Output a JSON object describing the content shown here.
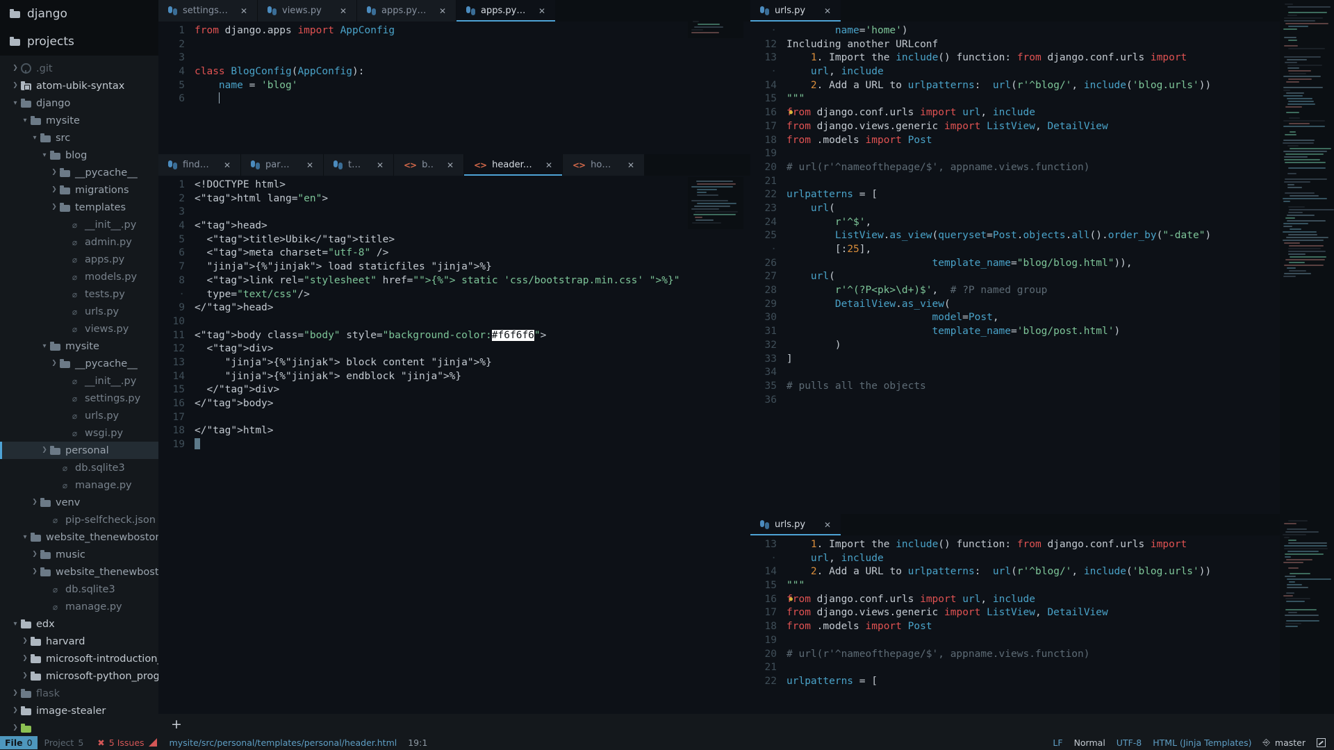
{
  "sidebar": {
    "headers": [
      {
        "label": "django",
        "icon": "folder-icon"
      },
      {
        "label": "projects",
        "icon": "folder-icon"
      }
    ],
    "tree": [
      {
        "label": ".git",
        "depth": 0,
        "type": "dir",
        "arrow": "right",
        "icon": "git-icon",
        "tone": "dim"
      },
      {
        "label": "atom-ubik-syntax",
        "depth": 0,
        "type": "dir",
        "arrow": "right",
        "icon": "repo-icon",
        "tone": "bright"
      },
      {
        "label": "django",
        "depth": 0,
        "type": "dir",
        "arrow": "down",
        "icon": "folder-icon",
        "tone": "normal"
      },
      {
        "label": "mysite",
        "depth": 1,
        "type": "dir",
        "arrow": "down",
        "icon": "folder-icon",
        "tone": "normal"
      },
      {
        "label": "src",
        "depth": 2,
        "type": "dir",
        "arrow": "down",
        "icon": "folder-icon",
        "tone": "normal"
      },
      {
        "label": "blog",
        "depth": 3,
        "type": "dir",
        "arrow": "down",
        "icon": "folder-icon",
        "tone": "normal"
      },
      {
        "label": "__pycache__",
        "depth": 4,
        "type": "dir",
        "arrow": "right",
        "icon": "folder-icon",
        "tone": "normal"
      },
      {
        "label": "migrations",
        "depth": 4,
        "type": "dir",
        "arrow": "right",
        "icon": "folder-icon",
        "tone": "normal"
      },
      {
        "label": "templates",
        "depth": 4,
        "type": "dir",
        "arrow": "right",
        "icon": "folder-icon",
        "tone": "normal"
      },
      {
        "label": "__init__.py",
        "depth": 5,
        "type": "file",
        "arrow": "none",
        "icon": "file-icon",
        "tone": "normal"
      },
      {
        "label": "admin.py",
        "depth": 5,
        "type": "file",
        "arrow": "none",
        "icon": "file-icon",
        "tone": "normal"
      },
      {
        "label": "apps.py",
        "depth": 5,
        "type": "file",
        "arrow": "none",
        "icon": "file-icon",
        "tone": "normal"
      },
      {
        "label": "models.py",
        "depth": 5,
        "type": "file",
        "arrow": "none",
        "icon": "file-icon",
        "tone": "normal"
      },
      {
        "label": "tests.py",
        "depth": 5,
        "type": "file",
        "arrow": "none",
        "icon": "file-icon",
        "tone": "normal"
      },
      {
        "label": "urls.py",
        "depth": 5,
        "type": "file",
        "arrow": "none",
        "icon": "file-icon",
        "tone": "normal"
      },
      {
        "label": "views.py",
        "depth": 5,
        "type": "file",
        "arrow": "none",
        "icon": "file-icon",
        "tone": "normal"
      },
      {
        "label": "mysite",
        "depth": 3,
        "type": "dir",
        "arrow": "down",
        "icon": "folder-icon",
        "tone": "normal"
      },
      {
        "label": "__pycache__",
        "depth": 4,
        "type": "dir",
        "arrow": "right",
        "icon": "folder-icon",
        "tone": "normal"
      },
      {
        "label": "__init__.py",
        "depth": 5,
        "type": "file",
        "arrow": "none",
        "icon": "file-icon",
        "tone": "normal"
      },
      {
        "label": "settings.py",
        "depth": 5,
        "type": "file",
        "arrow": "none",
        "icon": "file-icon",
        "tone": "normal"
      },
      {
        "label": "urls.py",
        "depth": 5,
        "type": "file",
        "arrow": "none",
        "icon": "file-icon",
        "tone": "normal"
      },
      {
        "label": "wsgi.py",
        "depth": 5,
        "type": "file",
        "arrow": "none",
        "icon": "file-icon",
        "tone": "normal"
      },
      {
        "label": "personal",
        "depth": 3,
        "type": "dir",
        "arrow": "right",
        "icon": "folder-icon",
        "tone": "normal",
        "selected": true
      },
      {
        "label": "db.sqlite3",
        "depth": 4,
        "type": "file",
        "arrow": "none",
        "icon": "file-icon",
        "tone": "normal"
      },
      {
        "label": "manage.py",
        "depth": 4,
        "type": "file",
        "arrow": "none",
        "icon": "file-icon",
        "tone": "normal"
      },
      {
        "label": "venv",
        "depth": 2,
        "type": "dir",
        "arrow": "right",
        "icon": "folder-icon",
        "tone": "normal"
      },
      {
        "label": "pip-selfcheck.json",
        "depth": 3,
        "type": "file",
        "arrow": "none",
        "icon": "file-icon",
        "tone": "normal"
      },
      {
        "label": "website_thenewboston",
        "depth": 1,
        "type": "dir",
        "arrow": "down",
        "icon": "folder-icon",
        "tone": "normal"
      },
      {
        "label": "music",
        "depth": 2,
        "type": "dir",
        "arrow": "right",
        "icon": "folder-icon",
        "tone": "normal"
      },
      {
        "label": "website_thenewboston",
        "depth": 2,
        "type": "dir",
        "arrow": "right",
        "icon": "folder-icon",
        "tone": "normal"
      },
      {
        "label": "db.sqlite3",
        "depth": 3,
        "type": "file",
        "arrow": "none",
        "icon": "file-icon",
        "tone": "normal"
      },
      {
        "label": "manage.py",
        "depth": 3,
        "type": "file",
        "arrow": "none",
        "icon": "file-icon",
        "tone": "normal"
      },
      {
        "label": "edx",
        "depth": 0,
        "type": "dir",
        "arrow": "down",
        "icon": "folder-light",
        "tone": "bright"
      },
      {
        "label": "harvard",
        "depth": 1,
        "type": "dir",
        "arrow": "right",
        "icon": "folder-light",
        "tone": "bright"
      },
      {
        "label": "microsoft-introduction_to",
        "depth": 1,
        "type": "dir",
        "arrow": "right",
        "icon": "folder-light",
        "tone": "bright"
      },
      {
        "label": "microsoft-python_program",
        "depth": 1,
        "type": "dir",
        "arrow": "right",
        "icon": "folder-light",
        "tone": "bright"
      },
      {
        "label": "flask",
        "depth": 0,
        "type": "dir",
        "arrow": "right",
        "icon": "folder-icon",
        "tone": "dim"
      },
      {
        "label": "image-stealer",
        "depth": 0,
        "type": "dir",
        "arrow": "right",
        "icon": "folder-light",
        "tone": "bright"
      },
      {
        "label": "",
        "depth": 0,
        "type": "dir",
        "arrow": "right",
        "icon": "folder-green",
        "tone": "bright"
      }
    ]
  },
  "panes": {
    "top_left": {
      "tabs": [
        {
          "label": "settings.py",
          "icon": "python-icon",
          "active": false,
          "close": "✕"
        },
        {
          "label": "views.py",
          "icon": "python-icon",
          "active": false,
          "close": "✕"
        },
        {
          "label": "apps.py — personal",
          "icon": "python-icon",
          "active": false,
          "close": "✕"
        },
        {
          "label": "apps.py — blog",
          "icon": "python-icon",
          "active": true,
          "close": "✕"
        }
      ],
      "lines": [
        {
          "num": "1",
          "text": "from django.apps import AppConfig"
        },
        {
          "num": "2",
          "text": ""
        },
        {
          "num": "3",
          "text": ""
        },
        {
          "num": "4",
          "text": "class BlogConfig(AppConfig):"
        },
        {
          "num": "5",
          "text": "    name = 'blog'"
        },
        {
          "num": "6",
          "text": ""
        }
      ]
    },
    "bottom_left": {
      "tabs": [
        {
          "label": "find_elemen...",
          "icon": "python-icon",
          "active": false,
          "close": "✕"
        },
        {
          "label": "parsing_web...",
          "icon": "python-icon",
          "active": false,
          "close": "✕"
        },
        {
          "label": "testing.py",
          "icon": "python-icon",
          "active": false,
          "close": "✕"
        },
        {
          "label": "basic.html",
          "icon": "html-icon",
          "active": false,
          "close": "✕"
        },
        {
          "label": "header.html",
          "icon": "html-icon",
          "active": true,
          "close": "✕"
        },
        {
          "label": "home.html",
          "icon": "html-icon",
          "active": false,
          "close": "✕"
        }
      ],
      "lines": [
        {
          "num": "1",
          "text": "<!DOCTYPE html>"
        },
        {
          "num": "2",
          "text": "<html lang=\"en\">"
        },
        {
          "num": "3",
          "text": ""
        },
        {
          "num": "4",
          "text": "<head>"
        },
        {
          "num": "5",
          "text": "  <title>Ubik</title>"
        },
        {
          "num": "6",
          "text": "  <meta charset=\"utf-8\" />"
        },
        {
          "num": "7",
          "text": "  {% load staticfiles %}"
        },
        {
          "num": "8",
          "text": "  <link rel=\"stylesheet\" href=\"{% static 'css/bootstrap.min.css' %}\""
        },
        {
          "num": "",
          "text": "  type=\"text/css\"/>"
        },
        {
          "num": "9",
          "text": "</head>"
        },
        {
          "num": "10",
          "text": ""
        },
        {
          "num": "11",
          "text": "<body class=\"body\" style=\"background-color:#f6f6f6\">"
        },
        {
          "num": "12",
          "text": "  <div>"
        },
        {
          "num": "13",
          "text": "     {% block content %}"
        },
        {
          "num": "14",
          "text": "     {% endblock %}"
        },
        {
          "num": "15",
          "text": "  </div>"
        },
        {
          "num": "16",
          "text": "</body>"
        },
        {
          "num": "17",
          "text": ""
        },
        {
          "num": "18",
          "text": "</html>"
        },
        {
          "num": "19",
          "text": ""
        }
      ],
      "highlight_token": "#f6f6f6"
    },
    "top_right": {
      "tabs": [
        {
          "label": "urls.py",
          "icon": "python-icon",
          "active": true,
          "close": "✕"
        }
      ],
      "lines": [
        {
          "num": "",
          "text": "        name='home')"
        },
        {
          "num": "12",
          "text": "Including another URLconf"
        },
        {
          "num": "13",
          "text": "    1. Import the include() function: from django.conf.urls import"
        },
        {
          "num": "",
          "text": "    url, include"
        },
        {
          "num": "14",
          "text": "    2. Add a URL to urlpatterns:  url(r'^blog/', include('blog.urls'))"
        },
        {
          "num": "15",
          "text": "\"\"\""
        },
        {
          "num": "16",
          "text": "from django.conf.urls import url, include"
        },
        {
          "num": "17",
          "text": "from django.views.generic import ListView, DetailView"
        },
        {
          "num": "18",
          "text": "from .models import Post"
        },
        {
          "num": "19",
          "text": ""
        },
        {
          "num": "20",
          "text": "# url(r'^nameofthepage/$', appname.views.function)"
        },
        {
          "num": "21",
          "text": ""
        },
        {
          "num": "22",
          "text": "urlpatterns = ["
        },
        {
          "num": "23",
          "text": "    url("
        },
        {
          "num": "24",
          "text": "        r'^$',"
        },
        {
          "num": "25",
          "text": "        ListView.as_view(queryset=Post.objects.all().order_by(\"-date\")"
        },
        {
          "num": "",
          "text": "        [:25],"
        },
        {
          "num": "26",
          "text": "                        template_name=\"blog/blog.html\")),"
        },
        {
          "num": "27",
          "text": "    url("
        },
        {
          "num": "28",
          "text": "        r'^(?P<pk>\\d+)$',  # ?P named group"
        },
        {
          "num": "29",
          "text": "        DetailView.as_view("
        },
        {
          "num": "30",
          "text": "                        model=Post,"
        },
        {
          "num": "31",
          "text": "                        template_name='blog/post.html')"
        },
        {
          "num": "32",
          "text": "        )"
        },
        {
          "num": "33",
          "text": "]"
        },
        {
          "num": "34",
          "text": ""
        },
        {
          "num": "35",
          "text": "# pulls all the objects"
        },
        {
          "num": "36",
          "text": ""
        }
      ]
    },
    "bottom_right": {
      "tabs": [
        {
          "label": "urls.py",
          "icon": "python-icon",
          "active": true,
          "close": "✕"
        }
      ],
      "lines": [
        {
          "num": "13",
          "text": "    1. Import the include() function: from django.conf.urls import"
        },
        {
          "num": "",
          "text": "    url, include"
        },
        {
          "num": "14",
          "text": "    2. Add a URL to urlpatterns:  url(r'^blog/', include('blog.urls'))"
        },
        {
          "num": "15",
          "text": "\"\"\""
        },
        {
          "num": "16",
          "text": "from django.conf.urls import url, include"
        },
        {
          "num": "17",
          "text": "from django.views.generic import ListView, DetailView"
        },
        {
          "num": "18",
          "text": "from .models import Post"
        },
        {
          "num": "19",
          "text": ""
        },
        {
          "num": "20",
          "text": "# url(r'^nameofthepage/$', appname.views.function)"
        },
        {
          "num": "21",
          "text": ""
        },
        {
          "num": "22",
          "text": "urlpatterns = ["
        }
      ]
    }
  },
  "plus_bar": {
    "label": "+"
  },
  "status": {
    "file_label": "File",
    "file_count": "0",
    "project_label": "Project",
    "project_count": "5",
    "issues_icon": "✖",
    "issues_label": "5 Issues",
    "path": "mysite/src/personal/templates/personal/header.html",
    "position": "19:1",
    "line_ending": "LF",
    "mode": "Normal",
    "encoding": "UTF-8",
    "grammar": "HTML (Jinja Templates)",
    "branch": "master",
    "branch_icon": "branch-icon",
    "right_icon": "pencil-square-icon"
  },
  "colors": {
    "accent": "#4ea3d6",
    "sidebar_bg": "#14181c",
    "editor_bg": "#0d1117",
    "tabbar_bg": "#0b0f13",
    "keyword": "#e05252",
    "string": "#7ec699",
    "comment": "#5d6b75",
    "number": "#d98d3b",
    "class": "#dbb84d",
    "function": "#4aa3c9",
    "error": "#d45656"
  }
}
